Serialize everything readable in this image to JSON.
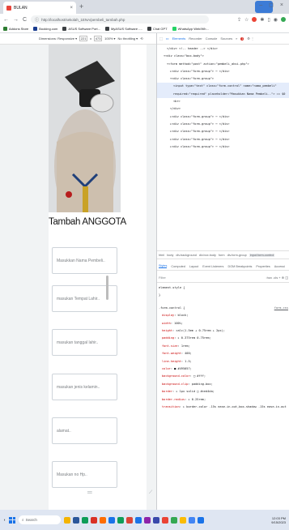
{
  "browser": {
    "tab_title": "BULAN",
    "tab_close": "×",
    "new_tab": "+",
    "window_controls": "– ◻ ×",
    "url": "http://localhost/sekolah_1ENA/pembeli_tambah.php",
    "nav": {
      "back": "←",
      "forward": "→",
      "reload": "C"
    }
  },
  "bookmarks": [
    {
      "label": "Addons Store",
      "color": "#2e7d32"
    },
    {
      "label": "Booking.com",
      "color": "#1a3d8f"
    },
    {
      "label": "ASUS Software Port...",
      "color": "#3c4043"
    },
    {
      "label": "MyASUS Software -...",
      "color": "#3c4043"
    },
    {
      "label": "Chat GPT",
      "color": "#3c4043"
    },
    {
      "label": "WhatsApp Web/Wh...",
      "color": "#25d366"
    }
  ],
  "device_toolbar": {
    "dimensions_label": "Dimensions: Responsive ▾",
    "width": "221",
    "times": "x",
    "height": "473",
    "zoom": "100% ▾",
    "throttle": "No throttling ▾"
  },
  "form": {
    "title": "Tambah ANGGOTA",
    "fields": [
      {
        "placeholder": "Masukkan Nama Pembeli.."
      },
      {
        "placeholder": "masukan Tempat Lahir.."
      },
      {
        "placeholder": "masukan tanggal lahir.."
      },
      {
        "placeholder": "masukan jenis kelamin.."
      },
      {
        "placeholder": "alamat.."
      },
      {
        "placeholder": "Masukan no Hp.."
      }
    ]
  },
  "devtools": {
    "tabs": [
      "Elements",
      "Recorder",
      "Console",
      "Sources",
      "»"
    ],
    "error_count": "1",
    "elements_lines": [
      {
        "indent": 3,
        "html": "</div> <!-- header --> </div>"
      },
      {
        "indent": 2,
        "html": "▾<div class=\"box-body\">"
      },
      {
        "indent": 3,
        "html": "▾<form method=\"post\" action=\"pembeli_aksi.php\">"
      },
      {
        "indent": 4,
        "html": "▸<div class=\"form-group\"> ⋯ </div>"
      },
      {
        "indent": 4,
        "html": "▾<div class=\"form-group\">"
      },
      {
        "indent": 5,
        "html": "<input type=\"text\" class=\"form-control\" name=\"nama_pembeli\""
      },
      {
        "indent": 5,
        "html": "required=\"required\" placeholder=\"Masukkan Nama Pembeli..\"> == $0"
      },
      {
        "indent": 5,
        "html": "<br>"
      },
      {
        "indent": 4,
        "html": "</div>"
      },
      {
        "indent": 4,
        "html": "▸<div class=\"form-group\"> ⋯ </div>"
      },
      {
        "indent": 4,
        "html": "▸<div class=\"form-group\"> ⋯ </div>"
      },
      {
        "indent": 4,
        "html": "▸<div class=\"form-group\"> ⋯ </div>"
      },
      {
        "indent": 4,
        "html": "▸<div class=\"form-group\"> ⋯ </div>"
      },
      {
        "indent": 4,
        "html": "▸<div class=\"form-group\"> ⋯ </div>"
      }
    ],
    "breadcrumbs": [
      "html",
      "body",
      "div.background",
      "div.box.body",
      "form",
      "div.form-group",
      "input.form-control"
    ],
    "sub_tabs": [
      "Styles",
      "Computed",
      "Layout",
      "Event Listeners",
      "DOM Breakpoints",
      "Properties",
      "Accessi"
    ],
    "filter_placeholder": "Filter",
    "filter_right": ":hov .cls + ⊕ ◫",
    "element_style": "element.style {",
    "element_style_close": "}",
    "rule_selector": ".form-control {",
    "rule_source": "form.css",
    "rule_props": [
      {
        "name": "display",
        "value": "block;"
      },
      {
        "name": "width",
        "value": "100%;"
      },
      {
        "name": "height",
        "value": "calc(1.5em + 0.75rem + 2px);"
      },
      {
        "name": "padding",
        "value": "▸ 0.375rem 0.75rem;"
      },
      {
        "name": "font-size",
        "value": "1rem;"
      },
      {
        "name": "font-weight",
        "value": "400;"
      },
      {
        "name": "line-height",
        "value": "1.5;"
      },
      {
        "name": "color",
        "value": "■ #495057;"
      },
      {
        "name": "background-color",
        "value": "□ #fff;"
      },
      {
        "name": "background-clip",
        "value": "padding-box;"
      },
      {
        "name": "border",
        "value": "▸ 1px solid □ #ced4da;"
      },
      {
        "name": "border-radius",
        "value": "▸ 0.25rem;"
      },
      {
        "name": "transition",
        "value": "▸ border-color .15s ease-in-out,box-shadow .15s ease-in-out"
      }
    ]
  },
  "taskbar": {
    "search_label": "Search",
    "time": "12:03 PM",
    "date": "9/15/2023",
    "icons": [
      "#f4b400",
      "#2b579a",
      "#0f9d58",
      "#d93025",
      "#ff6d00",
      "#1a73e8",
      "#0f9d58",
      "#db4437",
      "#1a73e8",
      "#8e24aa",
      "#3949ab",
      "#ea4335",
      "#34a853",
      "#fbbc05",
      "#4285f4",
      "#1a73e8"
    ]
  }
}
